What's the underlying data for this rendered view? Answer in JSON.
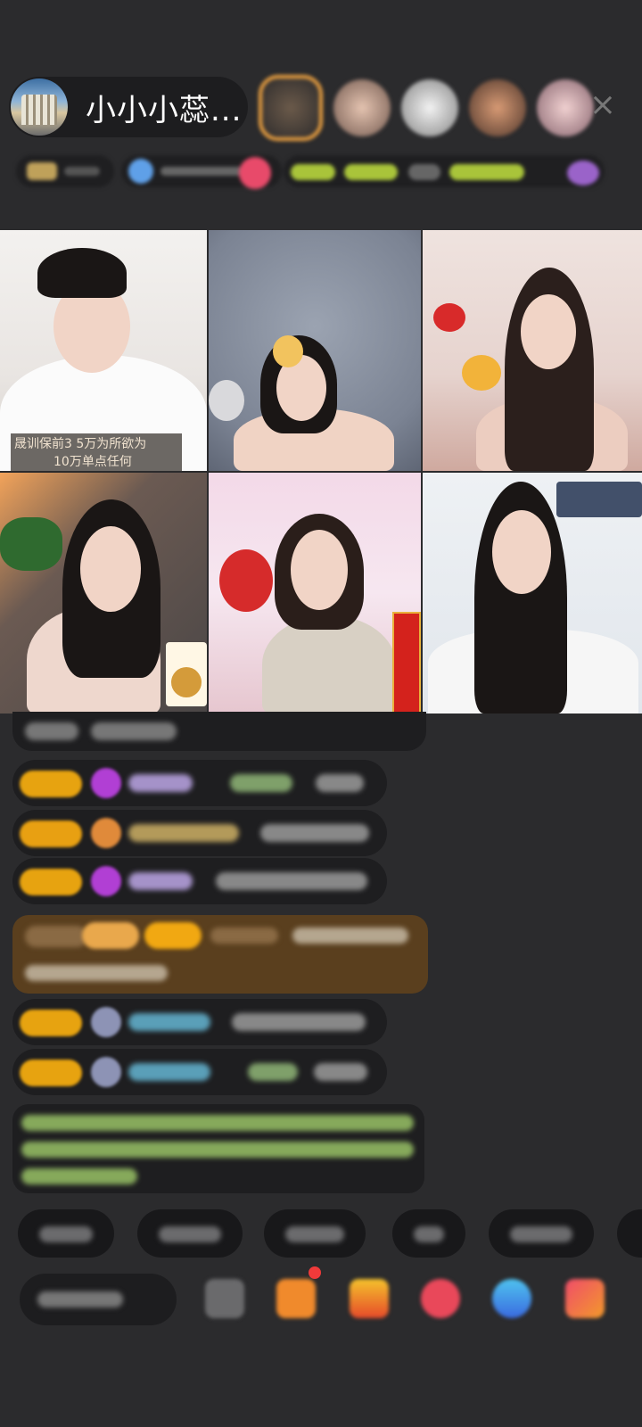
{
  "header": {
    "host_name": "小小小蕊...",
    "close_icon": "×"
  },
  "video_grid": {
    "caption_line1": "晟训保前3 5万为所欲为",
    "caption_line2": "10万单点任何"
  },
  "colors": {
    "background": "#2b2b2d",
    "badge_orange": "#e7a310",
    "avatar_ring": "#f1a441",
    "gift_banner": "#5a3f1e"
  }
}
